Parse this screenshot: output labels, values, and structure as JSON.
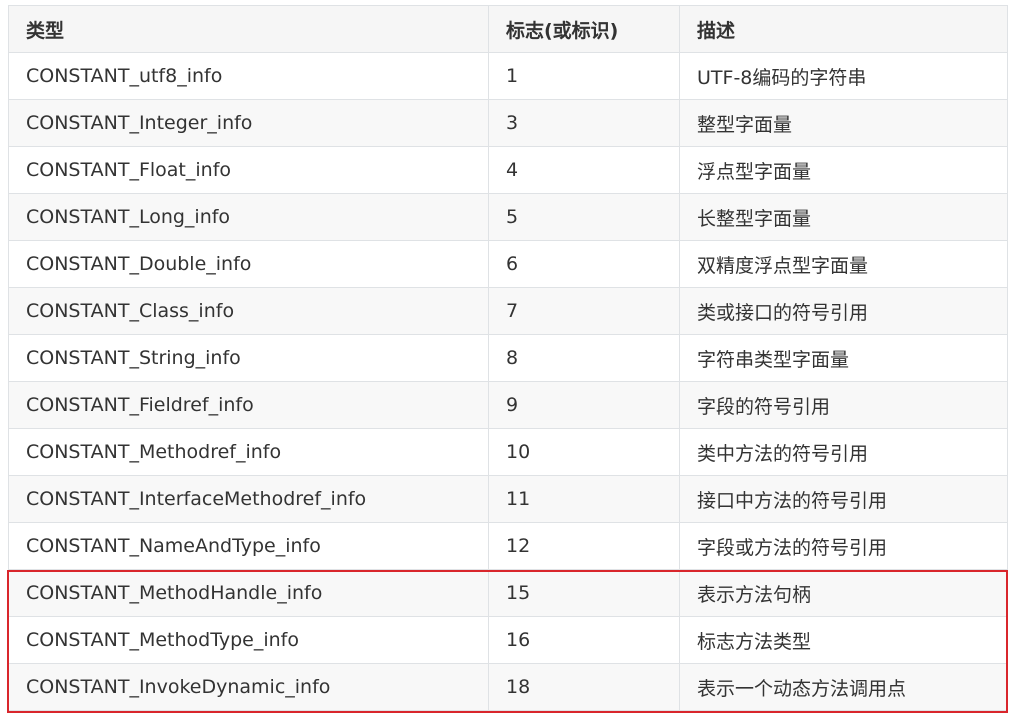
{
  "table": {
    "headers": [
      "类型",
      "标志(或标识)",
      "描述"
    ],
    "rows": [
      [
        "CONSTANT_utf8_info",
        "1",
        "UTF-8编码的字符串"
      ],
      [
        "CONSTANT_Integer_info",
        "3",
        "整型字面量"
      ],
      [
        "CONSTANT_Float_info",
        "4",
        "浮点型字面量"
      ],
      [
        "CONSTANT_Long_info",
        "5",
        "长整型字面量"
      ],
      [
        "CONSTANT_Double_info",
        "6",
        "双精度浮点型字面量"
      ],
      [
        "CONSTANT_Class_info",
        "7",
        "类或接口的符号引用"
      ],
      [
        "CONSTANT_String_info",
        "8",
        "字符串类型字面量"
      ],
      [
        "CONSTANT_Fieldref_info",
        "9",
        "字段的符号引用"
      ],
      [
        "CONSTANT_Methodref_info",
        "10",
        "类中方法的符号引用"
      ],
      [
        "CONSTANT_InterfaceMethodref_info",
        "11",
        "接口中方法的符号引用"
      ],
      [
        "CONSTANT_NameAndType_info",
        "12",
        "字段或方法的符号引用"
      ],
      [
        "CONSTANT_MethodHandle_info",
        "15",
        "表示方法句柄"
      ],
      [
        "CONSTANT_MethodType_info",
        "16",
        "标志方法类型"
      ],
      [
        "CONSTANT_InvokeDynamic_info",
        "18",
        "表示一个动态方法调用点"
      ]
    ]
  },
  "highlight": {
    "color": "#d9262c",
    "rows": [
      "CONSTANT_MethodHandle_info",
      "CONSTANT_MethodType_info",
      "CONSTANT_InvokeDynamic_info"
    ]
  },
  "colors": {
    "header_bg": "#f6f6f6",
    "stripe_bg": "#f8f8f8",
    "border": "#dfe2e5",
    "text": "#333333"
  }
}
